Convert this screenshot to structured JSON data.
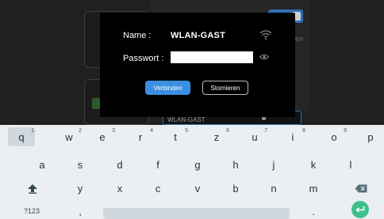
{
  "background": {
    "partial_hint": "en",
    "network_row_label": "WLAN-GAST"
  },
  "dialog": {
    "name_label": "Name :",
    "name_value": "WLAN-GAST",
    "password_label": "Passwort :",
    "password_value": "",
    "connect_label": "Verbinden",
    "cancel_label": "Stornieren"
  },
  "keyboard": {
    "row1": [
      {
        "key": "q",
        "num": "1"
      },
      {
        "key": "w",
        "num": "2"
      },
      {
        "key": "e",
        "num": "3"
      },
      {
        "key": "r",
        "num": "4"
      },
      {
        "key": "t",
        "num": "5"
      },
      {
        "key": "z",
        "num": "6"
      },
      {
        "key": "u",
        "num": "7"
      },
      {
        "key": "i",
        "num": "8"
      },
      {
        "key": "o",
        "num": "9"
      },
      {
        "key": "p",
        "num": ""
      }
    ],
    "row2": [
      "a",
      "s",
      "d",
      "f",
      "g",
      "h",
      "j",
      "k",
      "l"
    ],
    "row3": [
      "y",
      "x",
      "c",
      "v",
      "b",
      "n",
      "m"
    ],
    "num_toggle_label": "?123",
    "comma": ",",
    "period": "."
  },
  "colors": {
    "accent": "#3a8fe0",
    "enter": "#3fbf8c",
    "dialog_bg": "#000000",
    "keyboard_bg": "#eceff1"
  }
}
